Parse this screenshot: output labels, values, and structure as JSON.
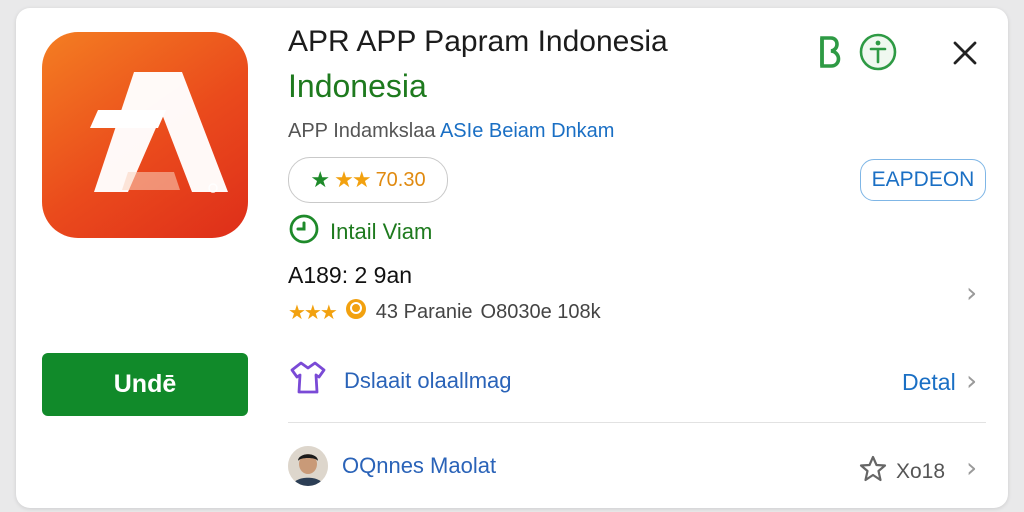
{
  "app": {
    "title_line1": "APR APP Papram Indonesia",
    "title_line2": "Indonesia",
    "subtitle_plain": "APP Indamkslaa",
    "subtitle_link": "ASIe Beiam Dnkam",
    "rating_value": "70.30",
    "install_status": "Intail Viam",
    "version_line": "A189: 2 9an",
    "meta_reviews": "43 Paranie",
    "meta_downloads": "O8030e 108k"
  },
  "header_icons": {
    "badge_glyph": "B",
    "icon_1": "b-badge-icon",
    "icon_2": "info-icon",
    "icon_3": "close-icon"
  },
  "buttons": {
    "install_label": "Undē",
    "expand_label": "EAPDEON",
    "detail_label": "Detal",
    "favorite_label": "Xo18"
  },
  "rows": {
    "description_label": "Dslaait olaallmag",
    "developer_label": "OQnnes Maolat"
  },
  "icons": {
    "app_logo": "app-logo-a-icon",
    "description": "shirt-icon",
    "developer": "avatar",
    "favorite": "star-outline-icon",
    "chevron": "chevron-right-icon"
  },
  "colors": {
    "brand_orange": "#f47e22",
    "brand_red": "#de2e1a",
    "install_green": "#118a2a",
    "title_green": "#1e7a1e",
    "link_blue": "#1a6fc4",
    "star_orange": "#f2a10f",
    "star_green": "#1e8a2a"
  }
}
